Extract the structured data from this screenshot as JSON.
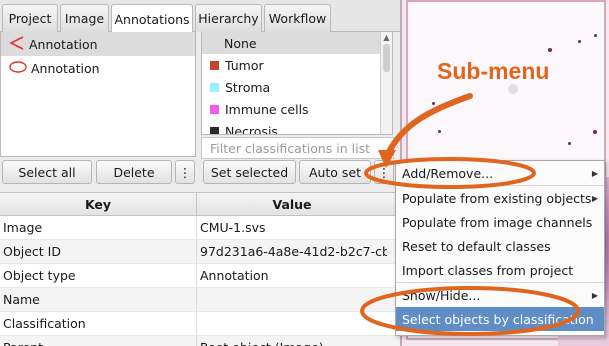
{
  "tabs": [
    "Project",
    "Image",
    "Annotations",
    "Hierarchy",
    "Workflow"
  ],
  "annotations": [
    {
      "label": "Annotation",
      "icon": "polygon-icon"
    },
    {
      "label": "Annotation",
      "icon": "ellipse-icon"
    }
  ],
  "classes": [
    {
      "label": "None",
      "color": ""
    },
    {
      "label": "Tumor",
      "color": "#c8432b"
    },
    {
      "label": "Stroma",
      "color": "#96f0ff"
    },
    {
      "label": "Immune cells",
      "color": "#f05cf0"
    },
    {
      "label": "Necrosis",
      "color": "#2a2a2a"
    }
  ],
  "filter_placeholder": "Filter classifications in list",
  "buttons": {
    "select_all": "Select all",
    "delete": "Delete",
    "more": "⋮",
    "set_selected": "Set selected",
    "auto_set": "Auto set",
    "more2": "⋮"
  },
  "table": {
    "headers": [
      "Key",
      "Value"
    ],
    "rows": [
      [
        "Image",
        "CMU-1.svs"
      ],
      [
        "Object ID",
        "97d231a6-4a8e-41d2-b2c7-cb..."
      ],
      [
        "Object type",
        "Annotation"
      ],
      [
        "Name",
        ""
      ],
      [
        "Classification",
        ""
      ],
      [
        "Parent",
        "Root object (Image)"
      ]
    ]
  },
  "menu": [
    {
      "label": "Add/Remove...",
      "submenu": true
    },
    {
      "label": "Populate from existing objects",
      "submenu": true
    },
    {
      "label": "Populate from image channels",
      "submenu": false
    },
    {
      "label": "Reset to default classes",
      "submenu": false
    },
    {
      "label": "Import classes from project",
      "submenu": false
    },
    {
      "label": "Show/Hide...",
      "submenu": true
    },
    {
      "label": "Select objects by classification",
      "submenu": false
    }
  ],
  "callout": "Sub-menu",
  "colors": {
    "accent": "#e0651f",
    "menu_highlight": "#5f8ec6"
  }
}
